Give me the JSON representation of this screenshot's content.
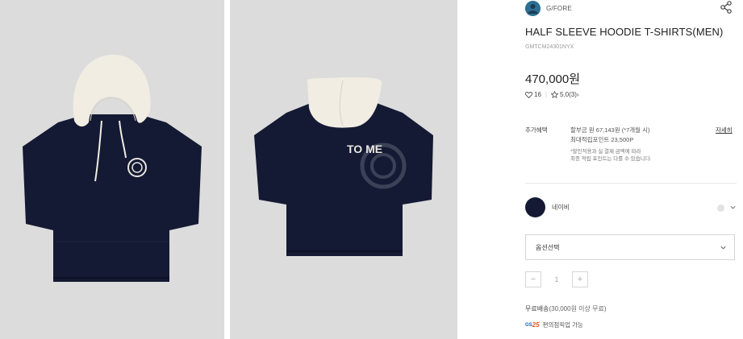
{
  "gallery": [
    {
      "alt": "front",
      "garment_color": "#141a33",
      "hood_color": "#f1ede3"
    },
    {
      "alt": "back",
      "graphic_text": "TO ME"
    }
  ],
  "brand": {
    "name": "G/FORE",
    "logo_color": "#2c6f93"
  },
  "share_icon": "share-icon",
  "product": {
    "title": "HALF SLEEVE HOODIE T-SHIRTS(MEN)",
    "code": "GMTCM24301NYX",
    "price": "470,000원"
  },
  "stats": {
    "likes": "16",
    "rating": "5.0",
    "reviews": "(3)",
    "chevron": "›"
  },
  "benefit": {
    "label": "추가혜택",
    "line1": "할부금 원 67,143원 (*7개월 시)",
    "line2": "최대적립포인트 23,500P",
    "note1": "*할인적용과 실 결제 금액에 따라",
    "note2": "최종 적립 포인트는 다를 수 있습니다.",
    "detail_link": "자세히"
  },
  "color": {
    "name": "네이비",
    "swatch_hex": "#141a33"
  },
  "option": {
    "placeholder": "옵션선택"
  },
  "quantity": {
    "minus": "−",
    "value": "1",
    "plus": "+"
  },
  "shipping": {
    "label": "무료배송",
    "note": "(30,000원 이상 무료)"
  },
  "pickup": {
    "gs_text": "GS",
    "gs_num": "25",
    "label": "편의점픽업 가능"
  }
}
